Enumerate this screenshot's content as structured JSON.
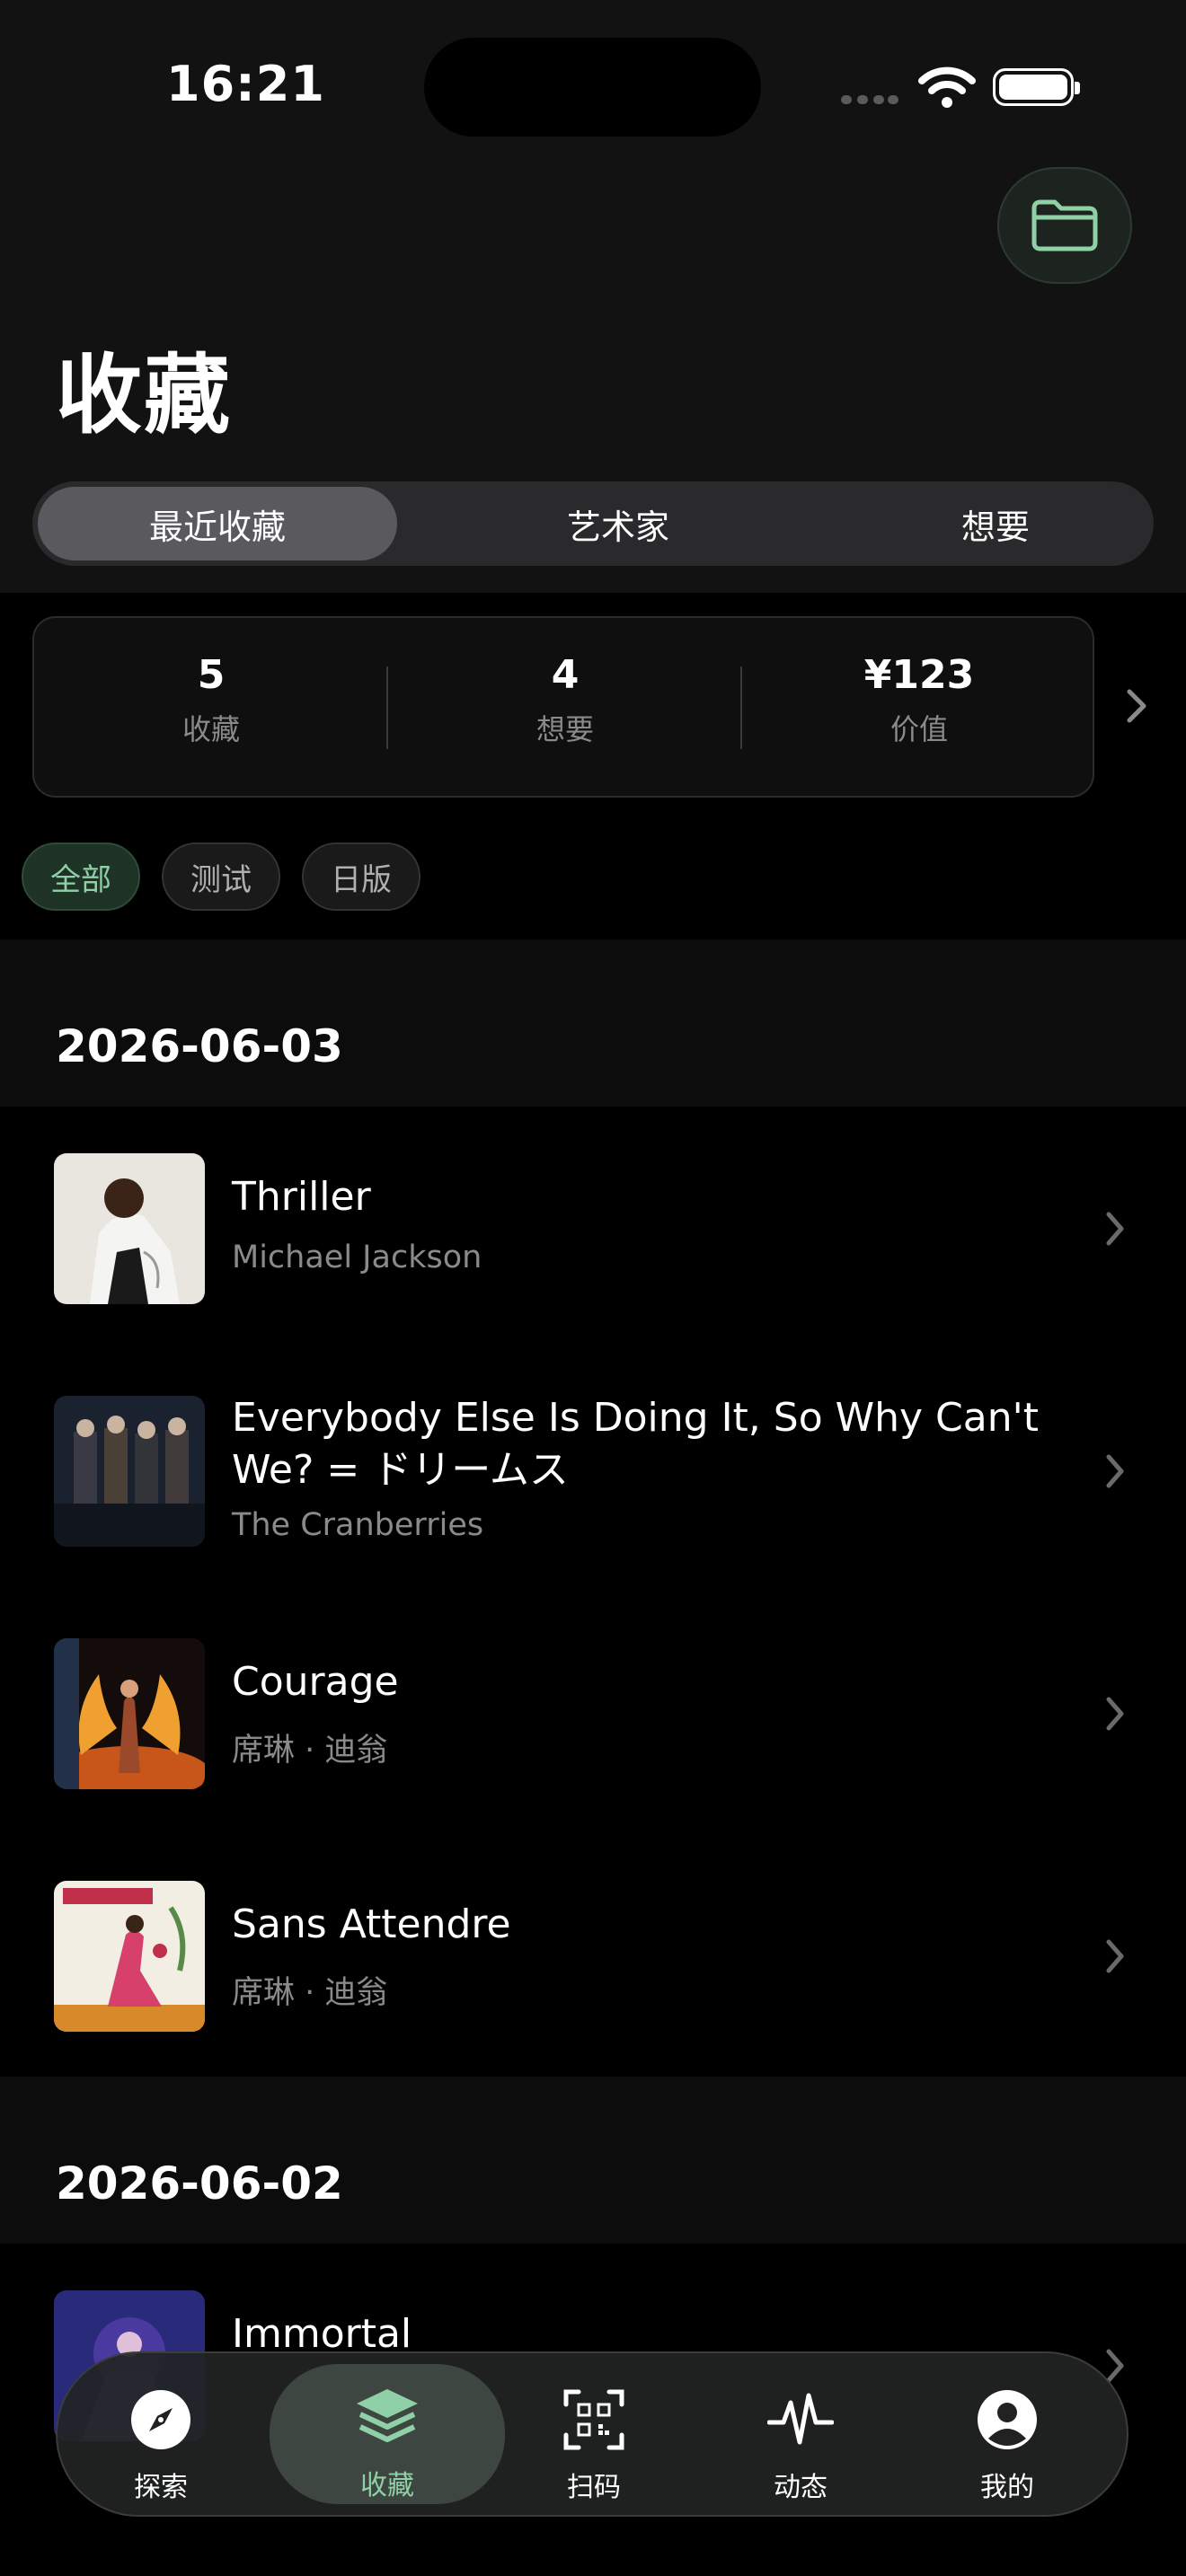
{
  "status_bar": {
    "time": "16:21"
  },
  "header": {
    "title": "收藏"
  },
  "segments": [
    {
      "label": "最近收藏",
      "active": true
    },
    {
      "label": "艺术家",
      "active": false
    },
    {
      "label": "想要",
      "active": false
    }
  ],
  "stats": [
    {
      "value": "5",
      "label": "收藏"
    },
    {
      "value": "4",
      "label": "想要"
    },
    {
      "value": "¥123",
      "label": "价值"
    }
  ],
  "filters": [
    {
      "label": "全部",
      "active": true
    },
    {
      "label": "测试",
      "active": false
    },
    {
      "label": "日版",
      "active": false
    }
  ],
  "groups": [
    {
      "date": "2026-06-03",
      "items": [
        {
          "title": "Thriller",
          "artist": "Michael Jackson"
        },
        {
          "title": "Everybody Else Is Doing It, So Why Can't We? = ドリームス",
          "artist": "The Cranberries"
        },
        {
          "title": "Courage",
          "artist": "席琳 · 迪翁"
        },
        {
          "title": "Sans Attendre",
          "artist": "席琳 · 迪翁"
        }
      ]
    },
    {
      "date": "2026-06-02",
      "items": [
        {
          "title": "Immortal",
          "artist": ""
        }
      ]
    }
  ],
  "tabbar": [
    {
      "label": "探索",
      "icon": "compass-icon",
      "active": false
    },
    {
      "label": "收藏",
      "icon": "layers-icon",
      "active": true
    },
    {
      "label": "扫码",
      "icon": "qr-scan-icon",
      "active": false
    },
    {
      "label": "动态",
      "icon": "pulse-icon",
      "active": false
    },
    {
      "label": "我的",
      "icon": "profile-icon",
      "active": false
    }
  ],
  "colors": {
    "accent": "#8fd0a6",
    "background": "#000000",
    "surface": "#121212"
  }
}
